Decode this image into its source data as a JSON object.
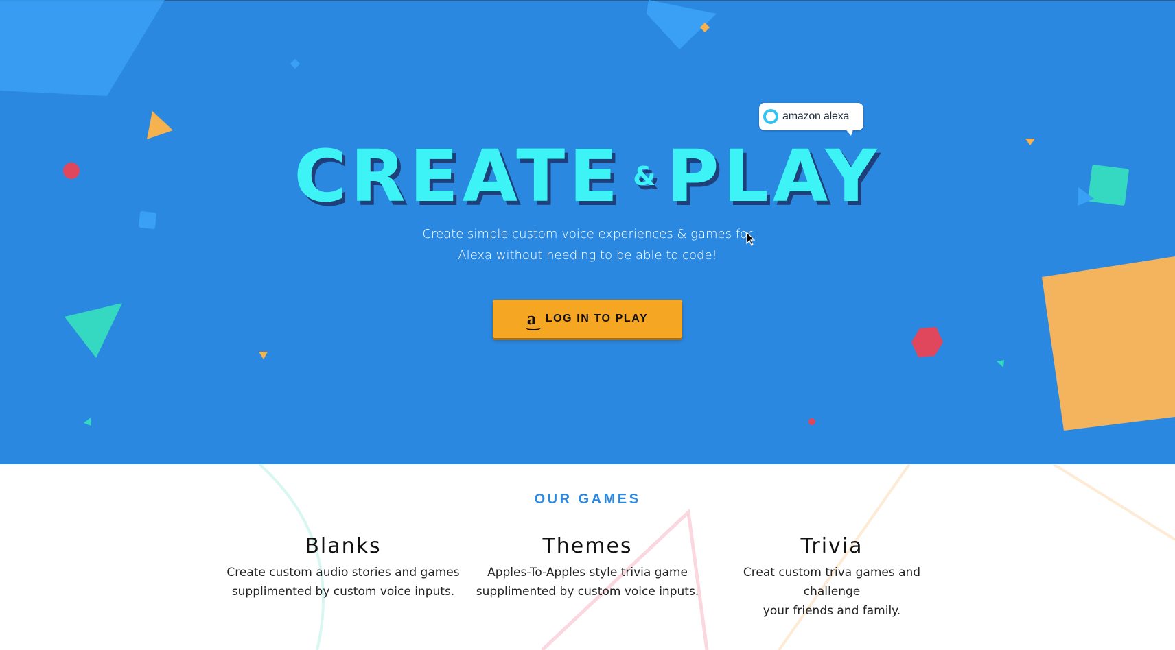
{
  "hero": {
    "badge_text": "amazon alexa",
    "title_part1": "CREATE",
    "title_amp": "&",
    "title_part2": "PLAY",
    "subtitle_line1": "Create simple custom voice experiences & games for",
    "subtitle_line2": "Alexa without needing to be able to code!",
    "login_button_label": "LOG IN TO PLAY",
    "login_icon_glyph": "a",
    "colors": {
      "background": "#2b88e0",
      "title": "#3ef3f5",
      "button": "#f5a623"
    }
  },
  "games": {
    "heading": "OUR GAMES",
    "items": [
      {
        "name": "Blanks",
        "desc_line1": "Create custom audio stories and games",
        "desc_line2": "supplimented by custom voice inputs."
      },
      {
        "name": "Themes",
        "desc_line1": "Apples-To-Apples style trivia game",
        "desc_line2": "supplimented by custom voice inputs."
      },
      {
        "name": "Trivia",
        "desc_line1": "Creat custom triva games and challenge",
        "desc_line2": "your friends and family."
      }
    ]
  },
  "icons": {
    "alexa": "alexa-ring-icon",
    "amazon": "amazon-logo-icon",
    "cursor": "mouse-cursor-icon"
  }
}
